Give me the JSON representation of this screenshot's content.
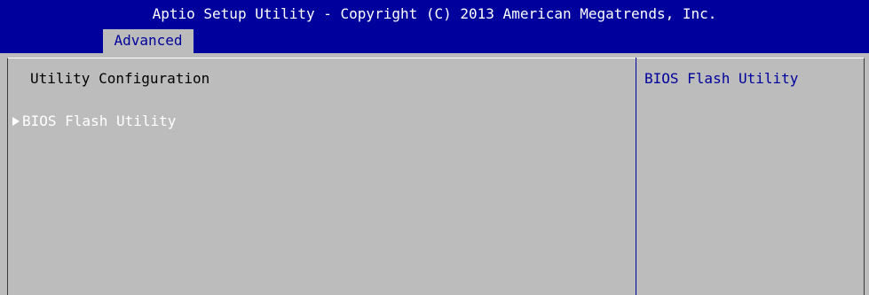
{
  "header": {
    "title": "Aptio Setup Utility - Copyright (C) 2013 American Megatrends, Inc.",
    "tabs": [
      {
        "label": "Advanced"
      }
    ]
  },
  "main": {
    "section_title": "Utility Configuration",
    "items": [
      {
        "label": "BIOS Flash Utility",
        "selected": true
      }
    ]
  },
  "help": {
    "text": "BIOS Flash Utility"
  },
  "colors": {
    "header_bg": "#00009c",
    "body_bg": "#bcbcbc",
    "selected_text": "#ffffff",
    "help_text": "#00009c"
  }
}
